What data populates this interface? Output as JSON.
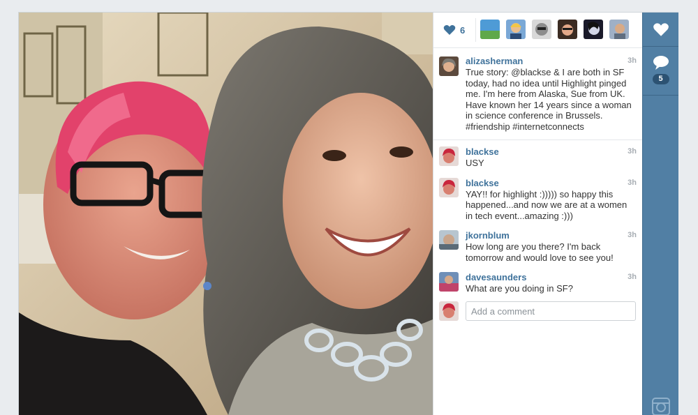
{
  "likes": {
    "count": "6"
  },
  "caption": {
    "username": "alizasherman",
    "time": "3h",
    "text": "True story: @blackse & I are both in SF today, had no idea until Highlight pinged me. I'm here from Alaska, Sue from UK. Have known her 14 years since a woman in science conference in Brussels. #friendship #internetconnects"
  },
  "comments": [
    {
      "username": "blackse",
      "time": "3h",
      "text": "USY"
    },
    {
      "username": "blackse",
      "time": "3h",
      "text": "YAY!! for highlight :))))) so happy this happened...and now we are at a women in tech event...amazing :)))"
    },
    {
      "username": "jkornblum",
      "time": "3h",
      "text": "How long are you there? I'm back tomorrow and would love to see you!"
    },
    {
      "username": "davesaunders",
      "time": "3h",
      "text": "What are you doing in SF?"
    }
  ],
  "add_comment": {
    "placeholder": "Add a comment"
  },
  "actions": {
    "comment_count": "5"
  },
  "colors": {
    "accent": "#3f729b",
    "sidebar": "#517fa4",
    "badge": "#2c5272"
  },
  "icons": {
    "like": "heart-icon",
    "comment": "speech-bubble-icon",
    "instagram": "camera-icon"
  }
}
